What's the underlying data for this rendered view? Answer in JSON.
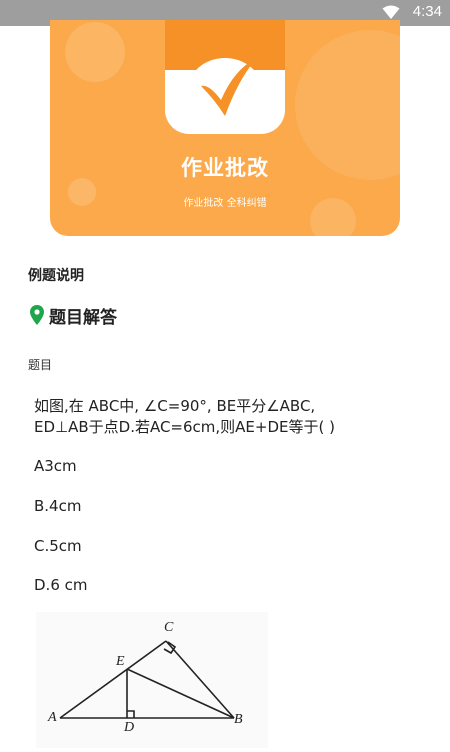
{
  "status_bar": {
    "time": "4:34"
  },
  "banner": {
    "title": "作业批改",
    "subtitle": "作业批改 全科纠错"
  },
  "section": {
    "title": "例题说明"
  },
  "answer_section": {
    "title": "题目解答"
  },
  "question": {
    "label": "题目",
    "text_line1": "如图,在 ABC中, ∠C=90°, BE平分∠ABC,",
    "text_line2": "ED⊥AB于点D.若AC=6cm,则AE+DE等于( )",
    "options": [
      "A3cm",
      "B.4cm",
      "C.5cm",
      "D.6 cm"
    ]
  },
  "figure": {
    "labels": {
      "A": "A",
      "B": "B",
      "C": "C",
      "D": "D",
      "E": "E"
    }
  }
}
